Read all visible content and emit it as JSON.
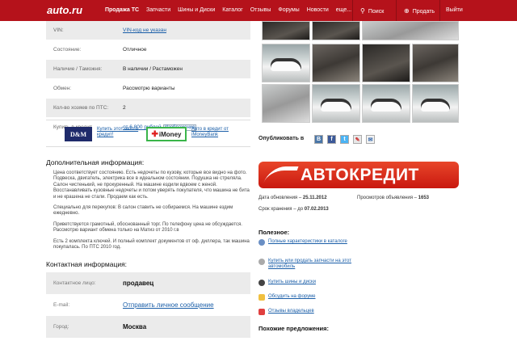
{
  "header": {
    "logo": "auto.ru",
    "nav": [
      "Продажа ТС",
      "Запчасти",
      "Шины и Диски",
      "Каталог",
      "Отзывы",
      "Форумы",
      "Новости",
      "еще..."
    ],
    "search": "Поиск",
    "sell": "Продать",
    "exit": "Выйти"
  },
  "specs": [
    {
      "label": "VIN:",
      "value": "VIN-код не указан",
      "link": true
    },
    {
      "label": "Состояние:",
      "value": "Отличное"
    },
    {
      "label": "Наличие / Таможня:",
      "value": "В наличии / Растаможен"
    },
    {
      "label": "Обмен:",
      "value": "Рассмотрю варианты"
    },
    {
      "label": "Кол-во хозяев по ПТС:",
      "value": "2"
    },
    {
      "label": "Купить в кредит",
      "value": "от 6 800 рублей",
      "link": true,
      "extra": "Изображение"
    }
  ],
  "credit": {
    "dm_logo": "D&M",
    "dm_link": "Купить этот авто в кредит!",
    "imoney_logo": "iMoney",
    "imoney_link": "Авто в кредит от iMoneyBank"
  },
  "description": {
    "title": "Дополнительная информация:",
    "paragraphs": [
      "Цена соответствует состоянию. Есть недочеты по кузову, которые все видно на фото. Подвеска, двигатель, электрика все в идеальном состоянии. Подушка не стреляла. Салон чистенький, не прокуренный. На машине ездили вдвоем с женой. Восстанавливать кузовные недочеты и потом уверять покупателя, что машина не бита и не крашена не стали. Продаем как есть.",
      "Специально для перекупов: В салон ставить не собираемся. На машине ездим ежедневно.",
      "Приветствуется грамотный, обоснованный торг. По телефону цена не обсуждается. Рассмотрю вариант обмена только на Матиз от 2010 г.в",
      "Есть 2 комплекта ключей. И полный комплект документов от оф. диллера, так машина покупалась. По ПТС 2010 год."
    ]
  },
  "contacts": {
    "title": "Контактная информация:",
    "rows": [
      {
        "label": "Контактное лицо:",
        "value": "продавец"
      },
      {
        "label": "E-mail:",
        "value": "Отправить личное сообщение"
      },
      {
        "label": "Город:",
        "value": "Москва"
      }
    ]
  },
  "share": {
    "label": "Опубликовать в",
    "icons": [
      "В",
      "f",
      "t",
      "✎",
      "✉"
    ]
  },
  "banner": {
    "text": "АВТОКРЕДИТ"
  },
  "meta": {
    "updated_label": "Дата обновления –",
    "updated": "25.11.2012",
    "views_label": "Просмотров объявления –",
    "views": "1653",
    "storage_label": "Срок хранения – до",
    "storage": "07.02.2013"
  },
  "useful": {
    "title": "Полезное:",
    "items": [
      "Полные характеристики в каталоге",
      "Купить или продать запчасти на этот автомобиль",
      "Купить шины и диски",
      "Обсудить на форуме",
      "Отзывы владельцев"
    ]
  },
  "similar": {
    "title": "Похожие предложения:"
  },
  "colors": {
    "brand": "#b5121b",
    "link": "#1a5ea8"
  }
}
